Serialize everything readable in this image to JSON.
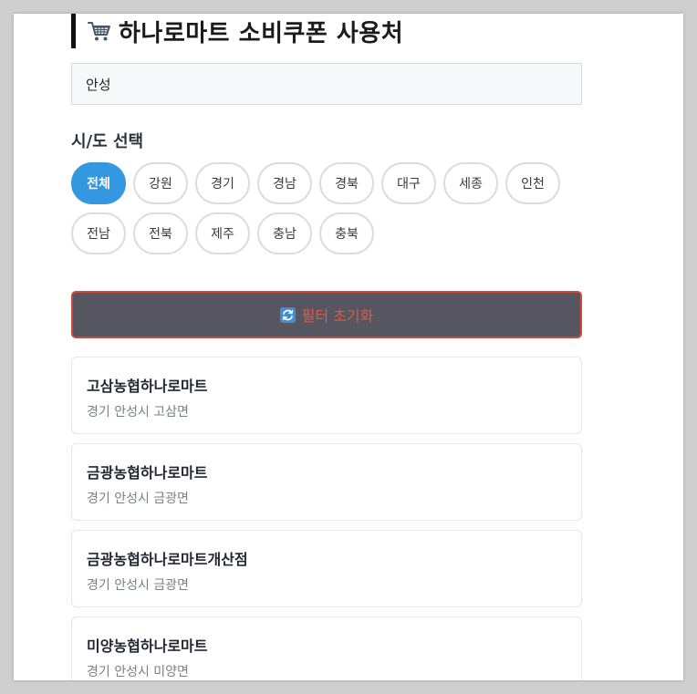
{
  "header": {
    "title": "하나로마트 소비쿠폰 사용처",
    "icon": "shopping-cart-icon"
  },
  "search": {
    "value": "안성"
  },
  "region_filter": {
    "label": "시/도 선택",
    "selected": "전체",
    "options": [
      "전체",
      "강원",
      "경기",
      "경남",
      "경북",
      "대구",
      "세종",
      "인천",
      "전남",
      "전북",
      "제주",
      "충남",
      "충북"
    ]
  },
  "reset_button": {
    "label": "필터 초기화",
    "icon": "refresh-icon"
  },
  "stores": [
    {
      "name": "고삼농협하나로마트",
      "address": "경기 안성시 고삼면"
    },
    {
      "name": "금광농협하나로마트",
      "address": "경기 안성시 금광면"
    },
    {
      "name": "금광농협하나로마트개산점",
      "address": "경기 안성시 금광면"
    },
    {
      "name": "미양농협하나로마트",
      "address": "경기 안성시 미양면"
    }
  ],
  "colors": {
    "accent": "#3398e0",
    "reset_bg": "#555660",
    "reset_border": "#d04a3c",
    "reset_text": "#e25a4a"
  }
}
